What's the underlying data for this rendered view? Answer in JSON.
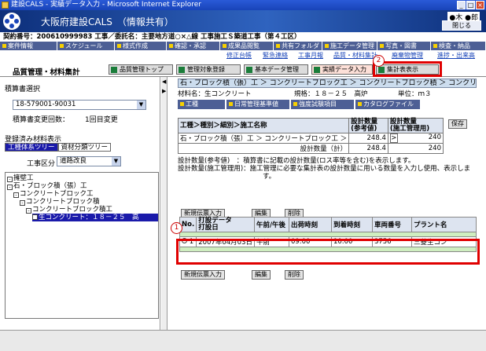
{
  "window": {
    "title": "建設CALS - 実績データ入力 - Microsoft Internet Explorer"
  },
  "header": {
    "app_title": "大阪府建設CALS　（情報共有）",
    "user": "●木 ●郎",
    "close_label": "閉じる"
  },
  "contract_line": "契約番号：200610999983 工事／委託名：主要地方道○×△線 工事施工Ｓ築道工事（第４工区）",
  "menu": [
    "案件情報",
    "スケジュール",
    "様式作成",
    "確認・承認",
    "成果品閲覧",
    "共有フォルダ",
    "施工データ管理",
    "写真・図書",
    "検査・納品"
  ],
  "sublinks": [
    "修正台帳",
    "緊急連絡",
    "工事月報",
    "品質・材料集計",
    "廃棄物管理",
    "進捗・出来高"
  ],
  "section": {
    "title": "品質管理・材料集計",
    "buttons": [
      "品質管理トップ",
      "管理対象登録",
      "基本データ管理",
      "実績データ入力",
      "集計表表示"
    ]
  },
  "left": {
    "label1": "積算書選択",
    "select1": "18-579001-90031",
    "change_label": "積算書変更回数：",
    "change_value": "1回目変更",
    "label2": "登録済み材料表示",
    "tab1": "工種体系ツリー",
    "tab2": "資材分類ツリー",
    "kubun_label": "工事区分",
    "kubun_value": "道路改良",
    "tree": [
      "擁壁工",
      "石・ブロック積（張）工",
      "コンクリートブロック工",
      "コンクリートブロック積",
      "コンクリートブロック積工",
      "生コンクリート：１８－２５　高"
    ]
  },
  "right": {
    "path": "石・ブロック積（張）工 ＞ コンクリートブロック工 ＞ コンクリートブロック積 ＞ コンクリ",
    "material": "材料名：生コンクリート",
    "spec": "規格：１８－２５　高炉",
    "unit": "単位：ｍ３",
    "tabs": [
      "工種",
      "日常管理基準値",
      "強度試験項目",
      "カタログファイル"
    ],
    "tbl_h1": "工種＞種別＞細別＞施工名称",
    "tbl_h2": "設計数量\n(参考値)",
    "tbl_h3": "設計数量\n(施工管理用)",
    "row1_name": "石・ブロック積（張）工 ＞ コンクリートブロック工 ＞",
    "row1_v1": "248.4",
    "row1_v2": "240",
    "row2_name": "設計数量（計）",
    "row2_v1": "248.4",
    "row2_v2": "240",
    "save": "保存",
    "note1": "設計数量(参考値)　：積算書に記載の設計数量(ロス率等を含む)を表示します。",
    "note2": "設計数量(施工管理用)：施工管理に必要な集計表の設計数量に用いる数量を入力し使用、表示しま",
    "note3": "す。",
    "btn_new": "新規伝票入力",
    "btn_edit": "編集",
    "btn_del": "削除",
    "cols": [
      "No.",
      "打設データ\n打設日",
      "午前/午後",
      "出荷時刻",
      "到着時刻",
      "車両番号",
      "プラント名"
    ],
    "row": {
      "no": "1",
      "date": "2007年04月03日",
      "ampm": "午前",
      "ship": "09:00",
      "arrive": "10:00",
      "car": "3756",
      "plant": "三菱生コン"
    },
    "marker1": "1",
    "marker2": "2"
  }
}
